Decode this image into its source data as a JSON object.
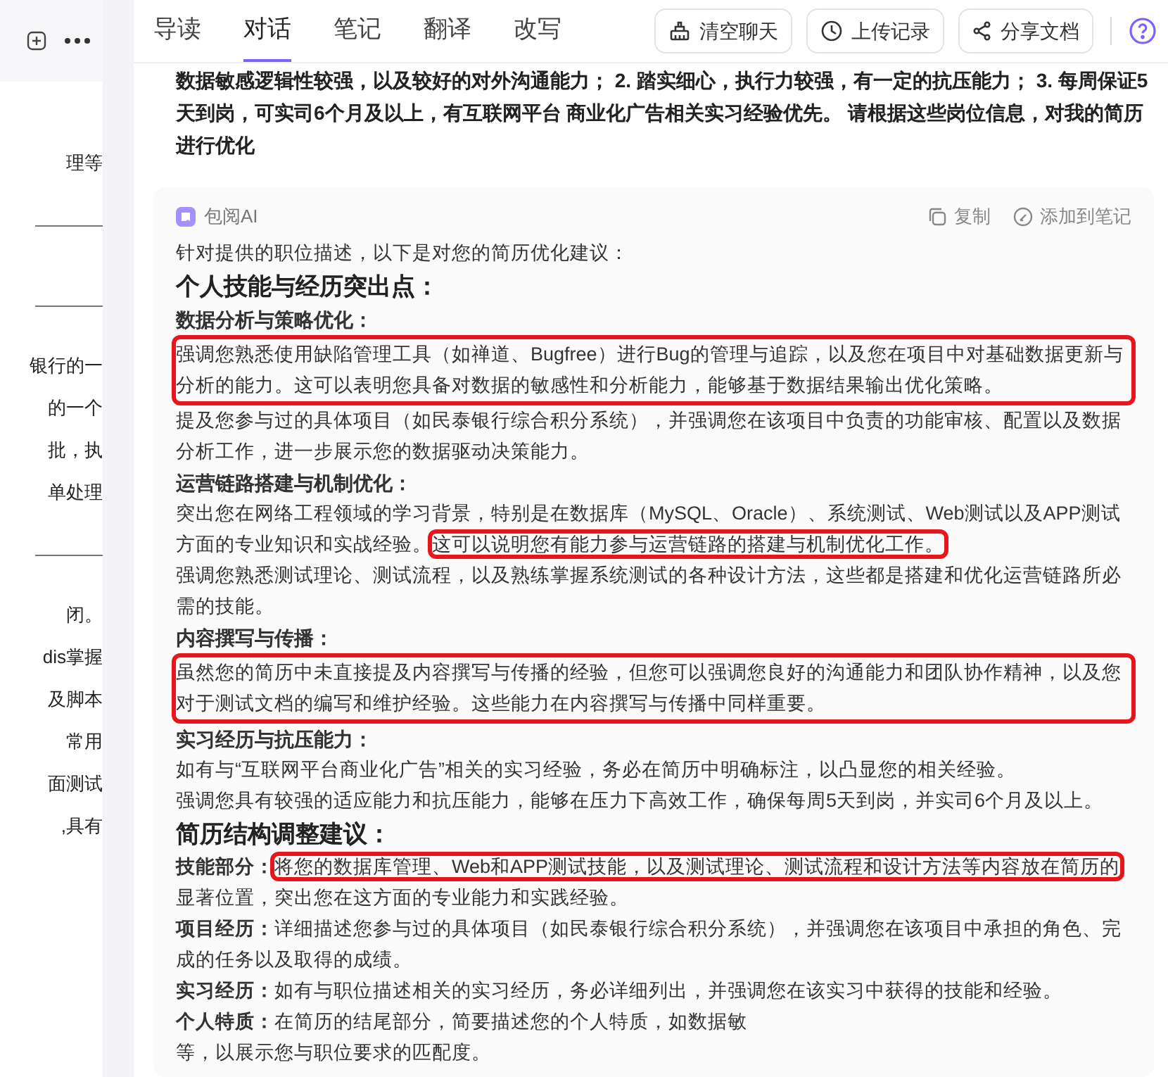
{
  "left_panel": {
    "items": [
      {
        "kind": "text",
        "text": "理等"
      },
      {
        "kind": "divider"
      },
      {
        "kind": "divider"
      },
      {
        "kind": "text",
        "text": "银行的一"
      },
      {
        "kind": "text",
        "text": "的一个"
      },
      {
        "kind": "text",
        "text": "批，执"
      },
      {
        "kind": "text",
        "text": "单处理"
      },
      {
        "kind": "divider"
      },
      {
        "kind": "text",
        "text": "闭。"
      },
      {
        "kind": "text",
        "text": "dis掌握"
      },
      {
        "kind": "text",
        "text": "及脚本"
      },
      {
        "kind": "text",
        "text": "常用"
      },
      {
        "kind": "text",
        "text": "面测试"
      },
      {
        "kind": "text",
        "text": ",具有"
      }
    ]
  },
  "tabs": [
    {
      "label": "导读",
      "selected": false
    },
    {
      "label": "对话",
      "selected": true
    },
    {
      "label": "笔记",
      "selected": false
    },
    {
      "label": "翻译",
      "selected": false
    },
    {
      "label": "改写",
      "selected": false
    }
  ],
  "toolbar_buttons": [
    {
      "kind": "clear",
      "label": "清空聊天"
    },
    {
      "kind": "history",
      "label": "上传记录"
    },
    {
      "kind": "share",
      "label": "分享文档"
    }
  ],
  "user_message": "数据敏感逻辑性较强，以及较好的对外沟通能力； 2. 踏实细心，执行力较强，有一定的抗压能力； 3. 每周保证5天到岗，可实司6个月及以上，有互联网平台 商业化广告相关实习经验优先。 请根据这些岗位信息，对我的简历进行优化",
  "ai_reply": {
    "sender": "包阅AI",
    "actions": [
      {
        "kind": "copy",
        "label": "复制"
      },
      {
        "kind": "note",
        "label": "添加到笔记"
      }
    ],
    "blocks": [
      {
        "kind": "paragraph",
        "segments": [
          {
            "text": "针对提供的职位描述，以下是对您的简历优化建议：",
            "highlighted": false
          }
        ]
      },
      {
        "kind": "heading",
        "text": "个人技能与经历突出点："
      },
      {
        "kind": "subheading",
        "text": "数据分析与策略优化："
      },
      {
        "kind": "paragraph",
        "segments": [
          {
            "text": "强调您熟悉使用缺陷管理工具（如禅道、Bugfree）进行Bug的管理与追踪，以及您在项目中对基础数据更新与分析的能力。这可以表明您具备对数据的敏感性和分析能力，能够基于数据结果输出优化策略。",
            "highlighted": true
          }
        ]
      },
      {
        "kind": "paragraph",
        "segments": [
          {
            "text": "提及您参与过的具体项目（如民泰银行综合积分系统），并强调您在该项目中负责的功能审核、配置以及数据分析工作，进一步展示您的数据驱动决策能力。",
            "highlighted": false
          }
        ]
      },
      {
        "kind": "subheading",
        "text": "运营链路搭建与机制优化："
      },
      {
        "kind": "paragraph",
        "segments": [
          {
            "text": "突出您在网络工程领域的学习背景，特别是在数据库（MySQL、Oracle）、系统测试、Web测试以及APP测试方面的专业知识和实战经验。",
            "highlighted": false
          },
          {
            "text": "这可以说明您有能力参与运营链路的搭建与机制优化工作。",
            "highlighted": true
          }
        ]
      },
      {
        "kind": "paragraph",
        "segments": [
          {
            "text": "强调您熟悉测试理论、测试流程，以及熟练掌握系统测试的各种设计方法，这些都是搭建和优化运营链路所必需的技能。",
            "highlighted": false
          }
        ]
      },
      {
        "kind": "subheading",
        "text": "内容撰写与传播："
      },
      {
        "kind": "paragraph",
        "segments": [
          {
            "text": "虽然您的简历中未直接提及内容撰写与传播的经验，但您可以强调您良好的沟通能力和团队协作精神，以及您对于测试文档的编写和维护经验。这些能力在内容撰写与传播中同样重要。",
            "highlighted": true
          }
        ]
      },
      {
        "kind": "subheading",
        "text": "实习经历与抗压能力："
      },
      {
        "kind": "paragraph",
        "segments": [
          {
            "text": "如有与“互联网平台商业化广告”相关的实习经验，务必在简历中明确标注，以凸显您的相关经验。",
            "highlighted": false
          }
        ]
      },
      {
        "kind": "paragraph",
        "segments": [
          {
            "text": "强调您具有较强的适应能力和抗压能力，能够在压力下高效工作，确保每周5天到岗，并实司6个月及以上。",
            "highlighted": false
          }
        ]
      },
      {
        "kind": "heading",
        "text": "简历结构调整建议："
      },
      {
        "kind": "paragraph",
        "label": "技能部分：",
        "segments": [
          {
            "text": "将您的数据库管理、Web和APP测试技能，以及测试理论、测试流程和设计方法等内容放在简历的",
            "highlighted": true
          },
          {
            "text": "显著位置，突出您在这方面的专业能力和实践经验。",
            "highlighted": false
          }
        ]
      },
      {
        "kind": "paragraph",
        "label": "项目经历：",
        "segments": [
          {
            "text": "详细描述您参与过的具体项目（如民泰银行综合积分系统），并强调您在该项目中承担的角色、完成的任务以及取得的成绩。",
            "highlighted": false
          }
        ]
      },
      {
        "kind": "paragraph",
        "label": "实习经历：",
        "segments": [
          {
            "text": "如有与职位描述相关的实习经历，务必详细列出，并强调您在该实习中获得的技能和经验。",
            "highlighted": false
          }
        ]
      },
      {
        "kind": "paragraph",
        "label": "个人特质：",
        "segments": [
          {
            "text": "在简历的结尾部分，简要描述您的个人特质，如数据敏",
            "highlighted": false
          },
          {
            "text": "等，以展示您与职位要求的匹配度。",
            "highlighted": false
          }
        ]
      }
    ]
  }
}
